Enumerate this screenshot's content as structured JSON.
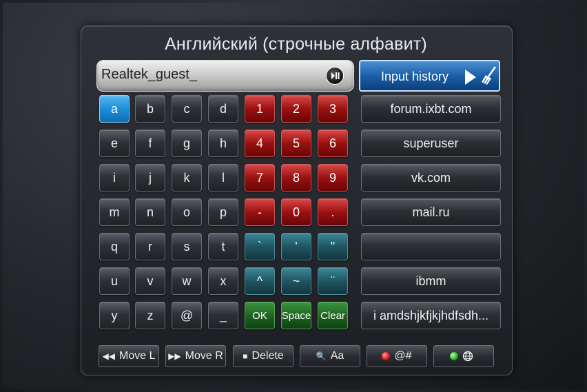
{
  "title": "Английский (строчные алфавит)",
  "input": {
    "value": "Realtek_guest_"
  },
  "keyboard": {
    "rows": [
      [
        {
          "label": "a",
          "style": "active"
        },
        {
          "label": "b"
        },
        {
          "label": "c"
        },
        {
          "label": "d"
        },
        {
          "label": "1",
          "style": "red"
        },
        {
          "label": "2",
          "style": "red"
        },
        {
          "label": "3",
          "style": "red"
        }
      ],
      [
        {
          "label": "e"
        },
        {
          "label": "f"
        },
        {
          "label": "g"
        },
        {
          "label": "h"
        },
        {
          "label": "4",
          "style": "red"
        },
        {
          "label": "5",
          "style": "red"
        },
        {
          "label": "6",
          "style": "red"
        }
      ],
      [
        {
          "label": "i"
        },
        {
          "label": "j"
        },
        {
          "label": "k"
        },
        {
          "label": "l"
        },
        {
          "label": "7",
          "style": "red"
        },
        {
          "label": "8",
          "style": "red"
        },
        {
          "label": "9",
          "style": "red"
        }
      ],
      [
        {
          "label": "m"
        },
        {
          "label": "n"
        },
        {
          "label": "o"
        },
        {
          "label": "p"
        },
        {
          "label": "-",
          "style": "red"
        },
        {
          "label": "0",
          "style": "red"
        },
        {
          "label": ".",
          "style": "red"
        }
      ],
      [
        {
          "label": "q"
        },
        {
          "label": "r"
        },
        {
          "label": "s"
        },
        {
          "label": "t"
        },
        {
          "label": "`",
          "style": "teal"
        },
        {
          "label": "'",
          "style": "teal"
        },
        {
          "label": "\"",
          "style": "teal"
        }
      ],
      [
        {
          "label": "u"
        },
        {
          "label": "v"
        },
        {
          "label": "w"
        },
        {
          "label": "x"
        },
        {
          "label": "^",
          "style": "teal"
        },
        {
          "label": "~",
          "style": "teal"
        },
        {
          "label": "¨",
          "style": "teal"
        }
      ],
      [
        {
          "label": "y"
        },
        {
          "label": "z"
        },
        {
          "label": "@"
        },
        {
          "label": "_"
        },
        {
          "label": "OK",
          "style": "green"
        },
        {
          "label": "Space",
          "style": "green"
        },
        {
          "label": "Clear",
          "style": "green"
        }
      ]
    ]
  },
  "history": {
    "header": "Input history",
    "items": [
      "forum.ixbt.com",
      "superuser",
      "vk.com",
      "mail.ru",
      "",
      "ibmm",
      "i amdshjkfjkjhdfsdh..."
    ]
  },
  "bottom_buttons": [
    {
      "icon": "rewind-icon",
      "glyph": "◀◀",
      "label": "Move L"
    },
    {
      "icon": "fast-forward-icon",
      "glyph": "▶▶",
      "label": "Move R"
    },
    {
      "icon": "stop-icon",
      "glyph": "■",
      "label": "Delete"
    },
    {
      "icon": "zoom-icon",
      "glyph": "🔍",
      "label": "Aa"
    },
    {
      "icon": "red-dot-icon",
      "glyph": "",
      "label": "@#"
    },
    {
      "icon": "green-dot-icon",
      "glyph": "",
      "label": ""
    }
  ],
  "colors": {
    "key_active": "#1d8ed8",
    "key_red": "#9a1010",
    "key_teal": "#1f5561",
    "key_green": "#1f6422",
    "history_header": "#1a5fa8"
  }
}
